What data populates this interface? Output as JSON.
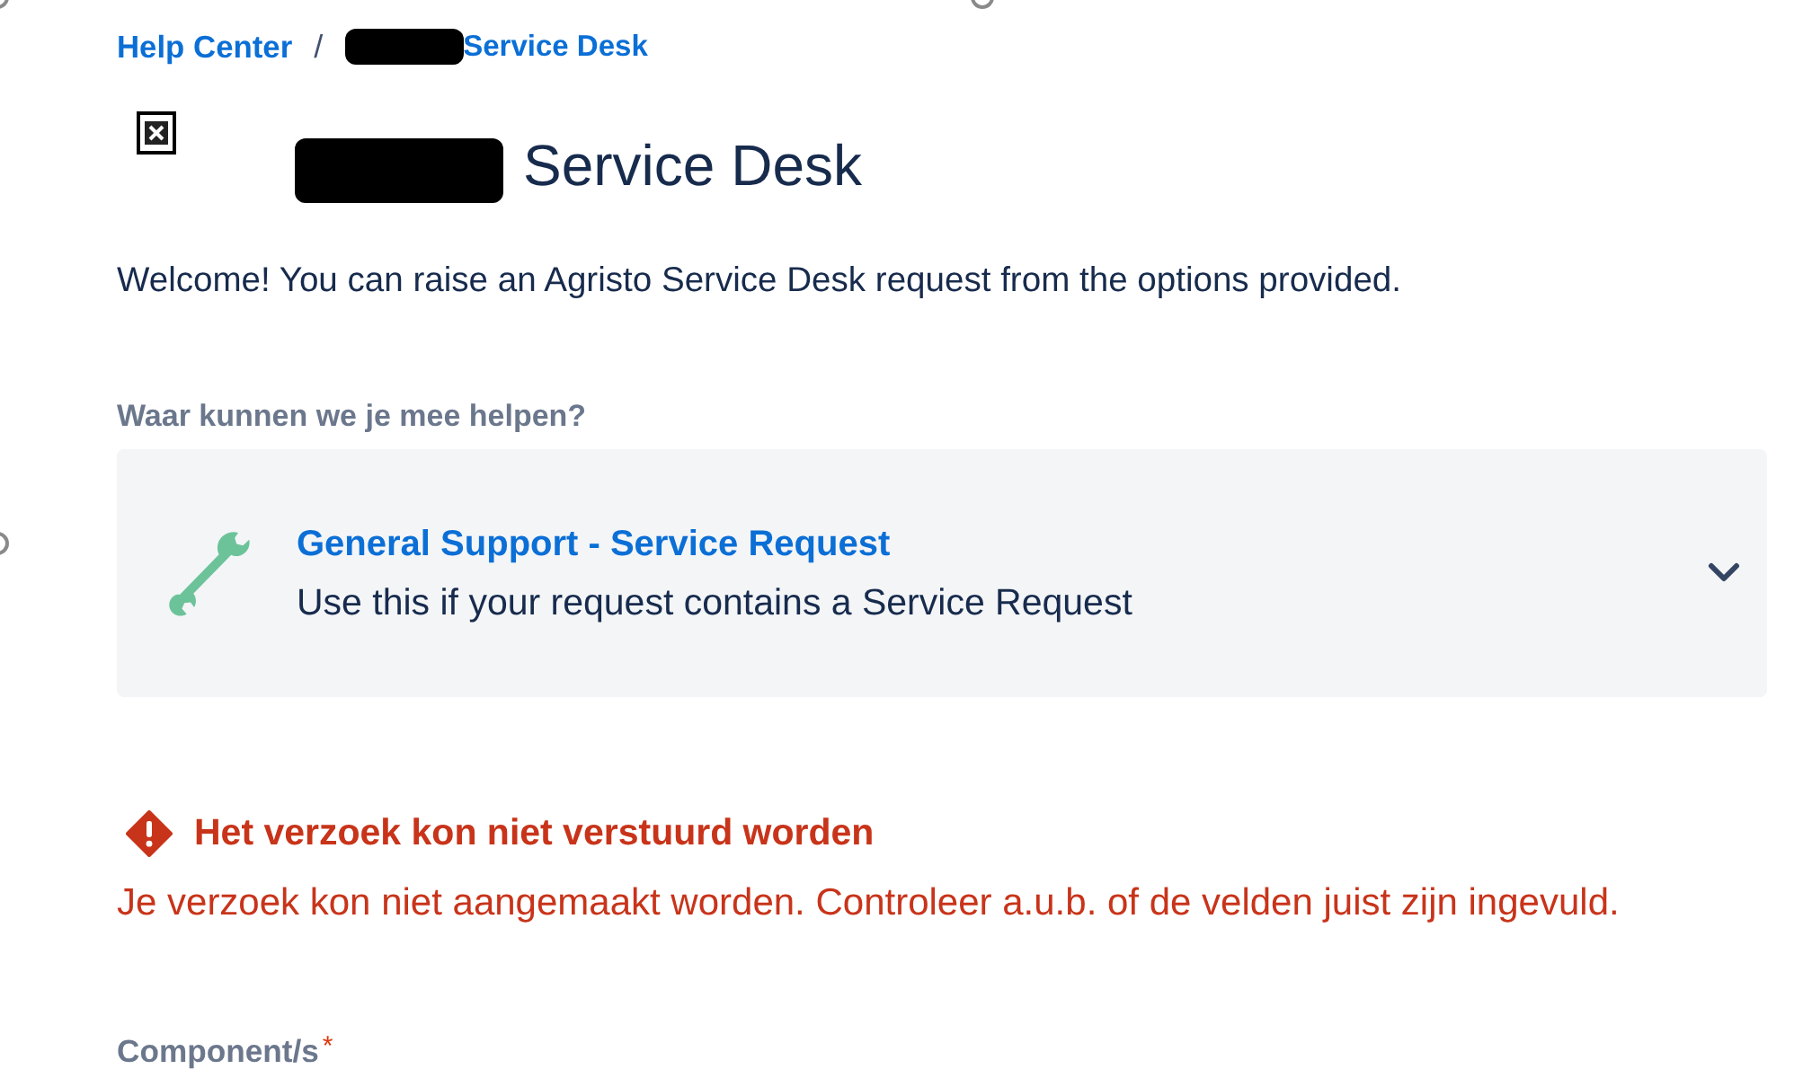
{
  "breadcrumb": {
    "items": [
      {
        "label": "Help Center",
        "redacted": false
      },
      {
        "label": "Service Desk",
        "redacted": true
      }
    ],
    "separator": "/"
  },
  "header": {
    "title": "Service Desk",
    "redacted": true
  },
  "welcome": "Welcome! You can raise an Agristo Service Desk request from the options provided.",
  "request_type": {
    "label": "Waar kunnen we je mee helpen?",
    "expanded": false,
    "option": {
      "title": "General Support - Service Request",
      "description": "Use this if your request contains a Service Request"
    }
  },
  "error": {
    "title": "Het verzoek kon niet verstuurd worden",
    "message": "Je verzoek kon niet aangemaakt worden. Controleer a.u.b. of de velden juist zijn ingevuld."
  },
  "field": {
    "label": "Component/s",
    "required_mark": "*"
  }
}
